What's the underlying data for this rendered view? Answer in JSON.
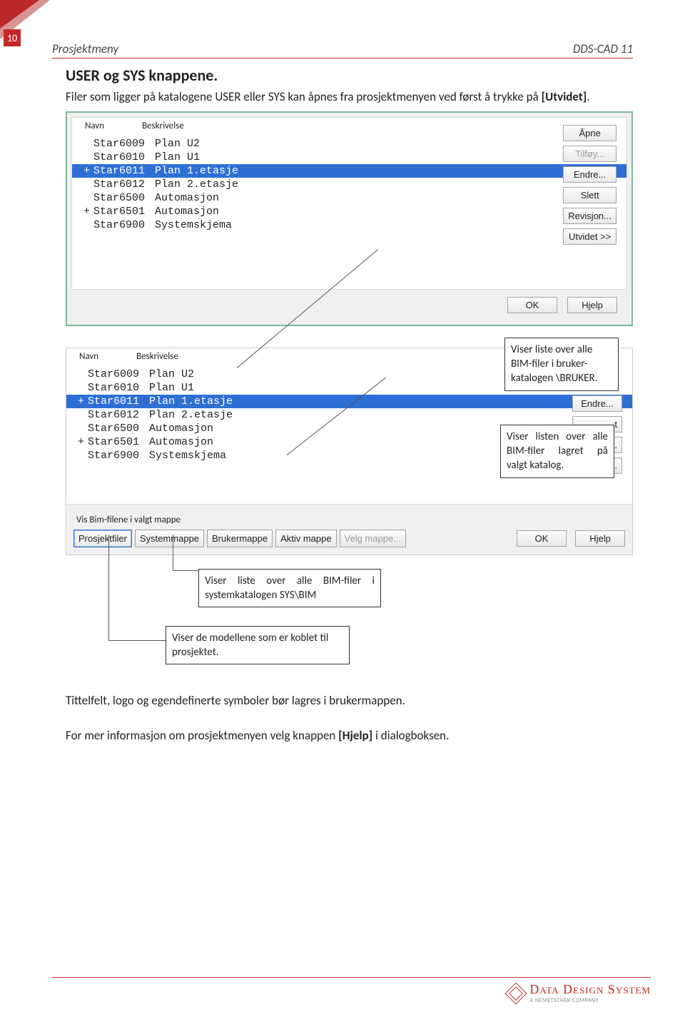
{
  "page": {
    "num": "10",
    "left": "Prosjektmeny",
    "right": "DDS-CAD 11"
  },
  "heading": "USER og SYS knappene.",
  "intro": {
    "text": "Filer som ligger på katalogene USER eller SYS kan åpnes fra prosjektmenyen ved først å trykke på ",
    "bold": "[Utvidet]",
    "suffix": "."
  },
  "cols": {
    "c1": "Navn",
    "c2": "Beskrivelse"
  },
  "rows": [
    {
      "m": "",
      "n": "Star6009",
      "d": "Plan U2"
    },
    {
      "m": "",
      "n": "Star6010",
      "d": "Plan U1"
    },
    {
      "m": "+",
      "n": "Star6011",
      "d": "Plan 1.etasje",
      "sel": true
    },
    {
      "m": "",
      "n": "Star6012",
      "d": "Plan 2.etasje"
    },
    {
      "m": "",
      "n": "Star6500",
      "d": "Automasjon"
    },
    {
      "m": "+",
      "n": "Star6501",
      "d": "Automasjon"
    },
    {
      "m": "",
      "n": "Star6900",
      "d": "Systemskjema"
    }
  ],
  "btns": {
    "open": "Åpne",
    "add": "Tilføy...",
    "edit": "Endre...",
    "del": "Slett",
    "rev": "Revisjon...",
    "ext": "Utvidet >>",
    "ok": "OK",
    "help": "Hjelp"
  },
  "btns2": {
    "edit": "Endre...",
    "del": "t",
    "rev": "n...",
    "ext": "el..."
  },
  "tabSection": {
    "label": "Vis Bim-filene i valgt mappe",
    "tabs": {
      "proj": "Prosjektfiler",
      "sys": "Systemmappe",
      "user": "Brukermappe",
      "active": "Aktiv mappe",
      "choose": "Velg mappe..."
    }
  },
  "callouts": {
    "c1": "Viser liste over alle BIM-filer i bruker-katalogen \\BRUKER.",
    "c2": "Viser listen over alle BIM-filer lagret på valgt katalog.",
    "c3": "Viser liste over alle BIM-filer i systemkatalogen SYS\\BIM",
    "c4": "Viser de modellene som er koblet til prosjektet."
  },
  "bottom": {
    "p1": "Tittelfelt, logo og egendefinerte symboler bør lagres i brukermappen.",
    "p2a": "For mer informasjon om prosjektmenyen velg knappen ",
    "p2b": "[Hjelp]",
    "p2c": " i dialogboksen."
  },
  "logo": {
    "main": "Data Design System",
    "sub": "A NEMETSCHEK COMPANY"
  }
}
